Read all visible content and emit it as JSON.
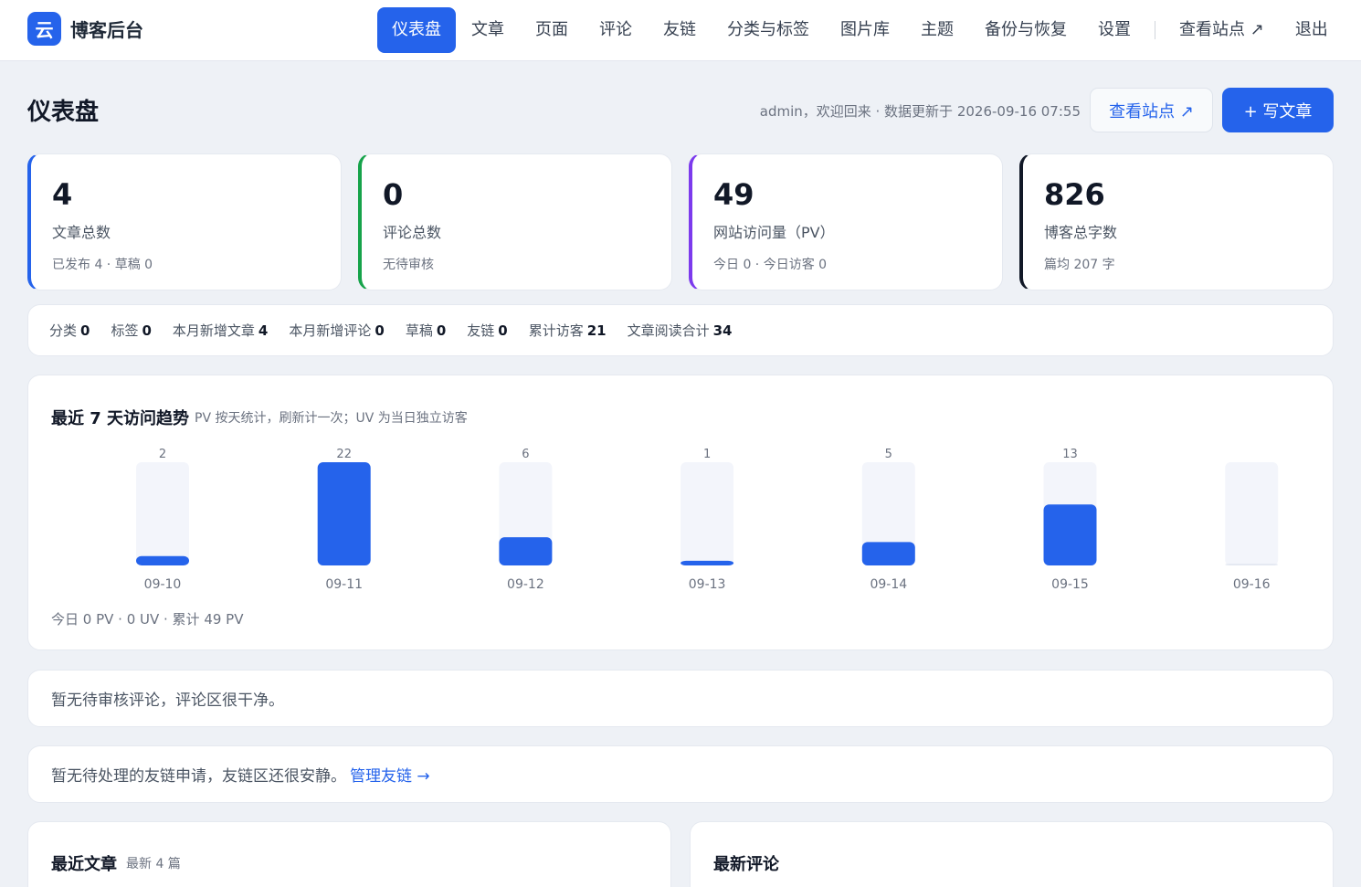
{
  "brand": {
    "logo_char": "云",
    "name": "博客后台"
  },
  "nav": {
    "items": [
      "仪表盘",
      "文章",
      "页面",
      "评论",
      "友链",
      "分类与标签",
      "图片库",
      "主题",
      "备份与恢复",
      "设置"
    ],
    "view_site": "查看站点 ↗",
    "logout": "退出"
  },
  "header": {
    "title": "仪表盘",
    "welcome": "admin，欢迎回来 · 数据更新于 2026-09-16 07:55",
    "view_site_button": "查看站点 ↗",
    "write_button": "+ 写文章"
  },
  "stats": [
    {
      "value": "4",
      "label": "文章总数",
      "sub": "已发布 4 · 草稿 0",
      "color": "#2563eb"
    },
    {
      "value": "0",
      "label": "评论总数",
      "sub": "无待审核",
      "color": "#16a34a"
    },
    {
      "value": "49",
      "label": "网站访问量（PV）",
      "sub": "今日 0 · 今日访客 0",
      "color": "#7c3aed"
    },
    {
      "value": "826",
      "label": "博客总字数",
      "sub": "篇均 207 字",
      "color": "#111827"
    }
  ],
  "summary": [
    {
      "label": "分类",
      "value": "0"
    },
    {
      "label": "标签",
      "value": "0"
    },
    {
      "label": "本月新增文章",
      "value": "4"
    },
    {
      "label": "本月新增评论",
      "value": "0"
    },
    {
      "label": "草稿",
      "value": "0"
    },
    {
      "label": "友链",
      "value": "0"
    },
    {
      "label": "累计访客",
      "value": "21"
    },
    {
      "label": "文章阅读合计",
      "value": "34"
    }
  ],
  "chart": {
    "title": "最近 7 天访问趋势",
    "subtitle": "PV 按天统计，刷新计一次；UV 为当日独立访客",
    "footer": "今日 0 PV · 0 UV · 累计 49 PV"
  },
  "chart_data": {
    "type": "bar",
    "categories": [
      "09-10",
      "09-11",
      "09-12",
      "09-13",
      "09-14",
      "09-15",
      "09-16"
    ],
    "values": [
      2,
      22,
      6,
      1,
      5,
      13,
      0
    ],
    "value_labels": [
      "2",
      "22",
      "6",
      "1",
      "5",
      "13",
      ""
    ],
    "ylim": [
      0,
      22
    ],
    "bar_color": "#2563eb",
    "track_color": "#f3f5fb"
  },
  "notices": {
    "comments": "暂无待审核评论，评论区很干净。",
    "links": "暂无待处理的友链申请，友链区还很安静。",
    "links_action": "管理友链 →"
  },
  "panels": {
    "recent_posts_title": "最近文章",
    "recent_posts_sub": "最新 4 篇",
    "recent_comments_title": "最新评论"
  }
}
